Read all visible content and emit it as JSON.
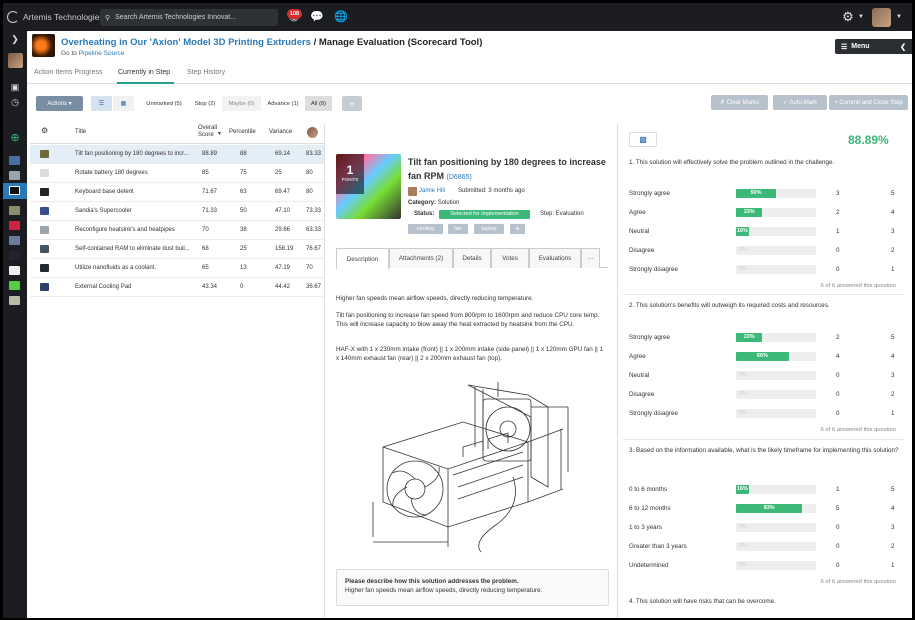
{
  "app": {
    "brand": "Artemis Technologies",
    "search_placeholder": "Search Artemis Technologies Innovat...",
    "notification_count": "108"
  },
  "header": {
    "challenge_title": "Overheating in Our 'Axion' Model 3D Printing Extruders",
    "page_title": " / Manage Evaluation (Scorecard Tool)",
    "goto_label": "Go to ",
    "pipeline_link": "Pipeline Source",
    "menu_label": "Menu"
  },
  "tabs": [
    "Action Items Progress",
    "Currently in Step",
    "Step History"
  ],
  "toolbar": {
    "actions_label": "Actions",
    "filters": [
      "Unmarked (5)",
      "Stop (2)",
      "Maybe (0)",
      "Advance (1)",
      "All (8)"
    ],
    "plus": "+",
    "clear_marks": "Clear Marks",
    "auto_mark": "Auto-Mark",
    "commit": "Commit and Close Step"
  },
  "table": {
    "headers": {
      "title": "Title",
      "overall": "Overall\nScore",
      "percentile": "Percentile",
      "variance": "Variance"
    },
    "rows": [
      {
        "title": "Tilt fan positioning by 180 degrees to incr...",
        "score": "88.89",
        "pct": "88",
        "var": "69.14",
        "last": "83.33"
      },
      {
        "title": "Rotate battery 180 degrees",
        "score": "85",
        "pct": "75",
        "var": "25",
        "last": "80"
      },
      {
        "title": "Keyboard base detent",
        "score": "71.67",
        "pct": "63",
        "var": "69.47",
        "last": "80"
      },
      {
        "title": "Sandia's Supercooler",
        "score": "71.33",
        "pct": "50",
        "var": "47.10",
        "last": "73.33"
      },
      {
        "title": "Reconfigure heatsink's and heatpipes",
        "score": "70",
        "pct": "38",
        "var": "29.66",
        "last": "63.33"
      },
      {
        "title": "Self-contained RAM to eliminate dust buil...",
        "score": "68",
        "pct": "25",
        "var": "158.19",
        "last": "76.67"
      },
      {
        "title": "Utilize nanofluids as a coolant.",
        "score": "65",
        "pct": "13",
        "var": "47.19",
        "last": "70"
      },
      {
        "title": "External Cooling Pad",
        "score": "43.34",
        "pct": "0",
        "var": "44.42",
        "last": "36.67"
      }
    ]
  },
  "detail": {
    "points": "1",
    "points_label": "POINTS",
    "title": "Tilt fan positioning by 180 degrees to increase fan RPM",
    "id": "(D6865)",
    "author": "Jamie Hill",
    "submitted": "Submitted: 3 months ago",
    "category_label": "Category:",
    "category": "Solution",
    "status_label": "Status:",
    "status": "Selected for Implementation",
    "step": "Step: Evaluation",
    "tags": [
      "cooling",
      "fan",
      "laptop",
      "+"
    ],
    "tabs": [
      "Description",
      "Attachments (2)",
      "Details",
      "Votes",
      "Evaluations",
      "···"
    ],
    "para1": "Higher fan speeds mean airflow speeds, directly reducing temperature.",
    "para2": "Tilt fan positioning to increase fan speed from 800rpm to 1600rpm and reduce CPU core temp. This will increase capacity to blow away the heat extracted by heatsink from the CPU.",
    "para3": "HAF-X with 1 x 230mm intake (front) || 1 x 200mm intake (side panel) || 1 x 120mm GPU fan || 1 x 140mm exhaust fan (rear) || 2 x 200mm exhaust fan (top).",
    "question": "Please describe how this solution addresses the problem.",
    "answer": "Higher fan speeds mean airflow speeds, directly reducing temperature."
  },
  "scorecard": {
    "score": "88.89%",
    "questions": [
      {
        "text": "1. This solution will effectively solve the problem outlined in the challenge.",
        "answered": "6 of 6 answered this question",
        "options": [
          {
            "label": "Strongly agree",
            "pct": 50,
            "pct_label": "50%",
            "count": "3",
            "weight": "5"
          },
          {
            "label": "Agree",
            "pct": 33,
            "pct_label": "33%",
            "count": "2",
            "weight": "4"
          },
          {
            "label": "Neutral",
            "pct": 16,
            "pct_label": "16%",
            "count": "1",
            "weight": "3"
          },
          {
            "label": "Disagree",
            "pct": 0,
            "pct_label": "0%",
            "count": "0",
            "weight": "2"
          },
          {
            "label": "Strongly disagree",
            "pct": 0,
            "pct_label": "0%",
            "count": "0",
            "weight": "1"
          }
        ]
      },
      {
        "text": "2. This solution's benefits will outweigh its required costs and resources.",
        "answered": "6 of 6 answered this question",
        "options": [
          {
            "label": "Strongly agree",
            "pct": 33,
            "pct_label": "33%",
            "count": "2",
            "weight": "5"
          },
          {
            "label": "Agree",
            "pct": 66,
            "pct_label": "66%",
            "count": "4",
            "weight": "4"
          },
          {
            "label": "Neutral",
            "pct": 0,
            "pct_label": "0%",
            "count": "0",
            "weight": "3"
          },
          {
            "label": "Disagree",
            "pct": 0,
            "pct_label": "0%",
            "count": "0",
            "weight": "2"
          },
          {
            "label": "Strongly disagree",
            "pct": 0,
            "pct_label": "0%",
            "count": "0",
            "weight": "1"
          }
        ]
      },
      {
        "text": "3. Based on the information available, what is the likely timeframe for implementing this solution?",
        "answered": "6 of 6 answered this question",
        "options": [
          {
            "label": "0 to 6 months",
            "pct": 16,
            "pct_label": "16%",
            "count": "1",
            "weight": "5"
          },
          {
            "label": "6 to 12 months",
            "pct": 83,
            "pct_label": "83%",
            "count": "5",
            "weight": "4"
          },
          {
            "label": "1 to 3 years",
            "pct": 0,
            "pct_label": "0%",
            "count": "0",
            "weight": "3"
          },
          {
            "label": "Greater than 3 years",
            "pct": 0,
            "pct_label": "0%",
            "count": "0",
            "weight": "2"
          },
          {
            "label": "Undetermined",
            "pct": 0,
            "pct_label": "0%",
            "count": "0",
            "weight": "1"
          }
        ]
      },
      {
        "text": "4. This solution will have risks that can be overcome."
      }
    ]
  }
}
